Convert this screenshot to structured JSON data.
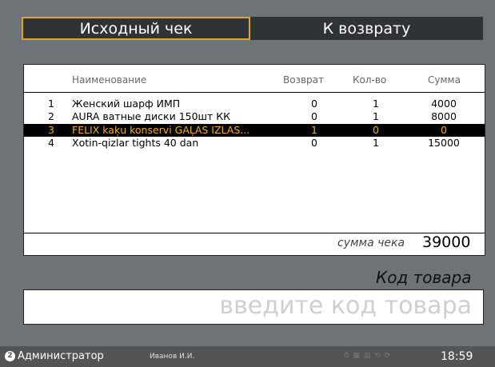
{
  "tabs": {
    "original": "Исходный чек",
    "return": "К возврату"
  },
  "table": {
    "columns": {
      "name": "Наименование",
      "returned": "Возврат",
      "qty": "Кол-во",
      "sum": "Сумма"
    },
    "rows": [
      {
        "num": "1",
        "name": "Женский шарф ИМП",
        "returned": "0",
        "qty": "1",
        "sum": "4000"
      },
      {
        "num": "2",
        "name": "AURA ватные диски 150шт КК",
        "returned": "0",
        "qty": "1",
        "sum": "8000"
      },
      {
        "num": "3",
        "name": "FELIX kaķu konservi GAĻAS IZLAS...",
        "returned": "1",
        "qty": "0",
        "sum": "0",
        "selected": true
      },
      {
        "num": "4",
        "name": "Xotin-qizlar tights 40 dan",
        "returned": "0",
        "qty": "1",
        "sum": "15000"
      }
    ],
    "total_label": "сумма чека",
    "total_value": "39000"
  },
  "code": {
    "label": "Код товара",
    "placeholder": "введите код товара"
  },
  "status": {
    "role": "Администратор",
    "user": "Иванов И.И.",
    "time": "18:59"
  },
  "colors": {
    "accent": "#e0a520",
    "selected_text": "#f0b020",
    "background": "#6e7378"
  }
}
